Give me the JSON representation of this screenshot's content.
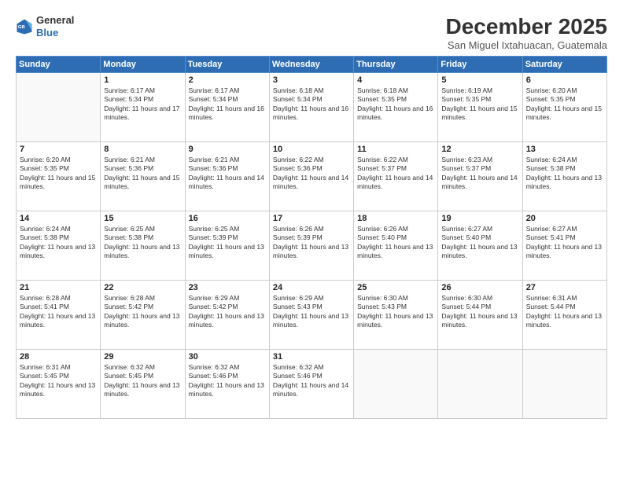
{
  "header": {
    "logo_general": "General",
    "logo_blue": "Blue",
    "month_title": "December 2025",
    "location": "San Miguel Ixtahuacan, Guatemala"
  },
  "weekdays": [
    "Sunday",
    "Monday",
    "Tuesday",
    "Wednesday",
    "Thursday",
    "Friday",
    "Saturday"
  ],
  "weeks": [
    [
      {
        "day": "",
        "sunrise": "",
        "sunset": "",
        "daylight": ""
      },
      {
        "day": "1",
        "sunrise": "Sunrise: 6:17 AM",
        "sunset": "Sunset: 5:34 PM",
        "daylight": "Daylight: 11 hours and 17 minutes."
      },
      {
        "day": "2",
        "sunrise": "Sunrise: 6:17 AM",
        "sunset": "Sunset: 5:34 PM",
        "daylight": "Daylight: 11 hours and 16 minutes."
      },
      {
        "day": "3",
        "sunrise": "Sunrise: 6:18 AM",
        "sunset": "Sunset: 5:34 PM",
        "daylight": "Daylight: 11 hours and 16 minutes."
      },
      {
        "day": "4",
        "sunrise": "Sunrise: 6:18 AM",
        "sunset": "Sunset: 5:35 PM",
        "daylight": "Daylight: 11 hours and 16 minutes."
      },
      {
        "day": "5",
        "sunrise": "Sunrise: 6:19 AM",
        "sunset": "Sunset: 5:35 PM",
        "daylight": "Daylight: 11 hours and 15 minutes."
      },
      {
        "day": "6",
        "sunrise": "Sunrise: 6:20 AM",
        "sunset": "Sunset: 5:35 PM",
        "daylight": "Daylight: 11 hours and 15 minutes."
      }
    ],
    [
      {
        "day": "7",
        "sunrise": "Sunrise: 6:20 AM",
        "sunset": "Sunset: 5:35 PM",
        "daylight": "Daylight: 11 hours and 15 minutes."
      },
      {
        "day": "8",
        "sunrise": "Sunrise: 6:21 AM",
        "sunset": "Sunset: 5:36 PM",
        "daylight": "Daylight: 11 hours and 15 minutes."
      },
      {
        "day": "9",
        "sunrise": "Sunrise: 6:21 AM",
        "sunset": "Sunset: 5:36 PM",
        "daylight": "Daylight: 11 hours and 14 minutes."
      },
      {
        "day": "10",
        "sunrise": "Sunrise: 6:22 AM",
        "sunset": "Sunset: 5:36 PM",
        "daylight": "Daylight: 11 hours and 14 minutes."
      },
      {
        "day": "11",
        "sunrise": "Sunrise: 6:22 AM",
        "sunset": "Sunset: 5:37 PM",
        "daylight": "Daylight: 11 hours and 14 minutes."
      },
      {
        "day": "12",
        "sunrise": "Sunrise: 6:23 AM",
        "sunset": "Sunset: 5:37 PM",
        "daylight": "Daylight: 11 hours and 14 minutes."
      },
      {
        "day": "13",
        "sunrise": "Sunrise: 6:24 AM",
        "sunset": "Sunset: 5:38 PM",
        "daylight": "Daylight: 11 hours and 13 minutes."
      }
    ],
    [
      {
        "day": "14",
        "sunrise": "Sunrise: 6:24 AM",
        "sunset": "Sunset: 5:38 PM",
        "daylight": "Daylight: 11 hours and 13 minutes."
      },
      {
        "day": "15",
        "sunrise": "Sunrise: 6:25 AM",
        "sunset": "Sunset: 5:38 PM",
        "daylight": "Daylight: 11 hours and 13 minutes."
      },
      {
        "day": "16",
        "sunrise": "Sunrise: 6:25 AM",
        "sunset": "Sunset: 5:39 PM",
        "daylight": "Daylight: 11 hours and 13 minutes."
      },
      {
        "day": "17",
        "sunrise": "Sunrise: 6:26 AM",
        "sunset": "Sunset: 5:39 PM",
        "daylight": "Daylight: 11 hours and 13 minutes."
      },
      {
        "day": "18",
        "sunrise": "Sunrise: 6:26 AM",
        "sunset": "Sunset: 5:40 PM",
        "daylight": "Daylight: 11 hours and 13 minutes."
      },
      {
        "day": "19",
        "sunrise": "Sunrise: 6:27 AM",
        "sunset": "Sunset: 5:40 PM",
        "daylight": "Daylight: 11 hours and 13 minutes."
      },
      {
        "day": "20",
        "sunrise": "Sunrise: 6:27 AM",
        "sunset": "Sunset: 5:41 PM",
        "daylight": "Daylight: 11 hours and 13 minutes."
      }
    ],
    [
      {
        "day": "21",
        "sunrise": "Sunrise: 6:28 AM",
        "sunset": "Sunset: 5:41 PM",
        "daylight": "Daylight: 11 hours and 13 minutes."
      },
      {
        "day": "22",
        "sunrise": "Sunrise: 6:28 AM",
        "sunset": "Sunset: 5:42 PM",
        "daylight": "Daylight: 11 hours and 13 minutes."
      },
      {
        "day": "23",
        "sunrise": "Sunrise: 6:29 AM",
        "sunset": "Sunset: 5:42 PM",
        "daylight": "Daylight: 11 hours and 13 minutes."
      },
      {
        "day": "24",
        "sunrise": "Sunrise: 6:29 AM",
        "sunset": "Sunset: 5:43 PM",
        "daylight": "Daylight: 11 hours and 13 minutes."
      },
      {
        "day": "25",
        "sunrise": "Sunrise: 6:30 AM",
        "sunset": "Sunset: 5:43 PM",
        "daylight": "Daylight: 11 hours and 13 minutes."
      },
      {
        "day": "26",
        "sunrise": "Sunrise: 6:30 AM",
        "sunset": "Sunset: 5:44 PM",
        "daylight": "Daylight: 11 hours and 13 minutes."
      },
      {
        "day": "27",
        "sunrise": "Sunrise: 6:31 AM",
        "sunset": "Sunset: 5:44 PM",
        "daylight": "Daylight: 11 hours and 13 minutes."
      }
    ],
    [
      {
        "day": "28",
        "sunrise": "Sunrise: 6:31 AM",
        "sunset": "Sunset: 5:45 PM",
        "daylight": "Daylight: 11 hours and 13 minutes."
      },
      {
        "day": "29",
        "sunrise": "Sunrise: 6:32 AM",
        "sunset": "Sunset: 5:45 PM",
        "daylight": "Daylight: 11 hours and 13 minutes."
      },
      {
        "day": "30",
        "sunrise": "Sunrise: 6:32 AM",
        "sunset": "Sunset: 5:46 PM",
        "daylight": "Daylight: 11 hours and 13 minutes."
      },
      {
        "day": "31",
        "sunrise": "Sunrise: 6:32 AM",
        "sunset": "Sunset: 5:46 PM",
        "daylight": "Daylight: 11 hours and 14 minutes."
      },
      {
        "day": "",
        "sunrise": "",
        "sunset": "",
        "daylight": ""
      },
      {
        "day": "",
        "sunrise": "",
        "sunset": "",
        "daylight": ""
      },
      {
        "day": "",
        "sunrise": "",
        "sunset": "",
        "daylight": ""
      }
    ]
  ]
}
